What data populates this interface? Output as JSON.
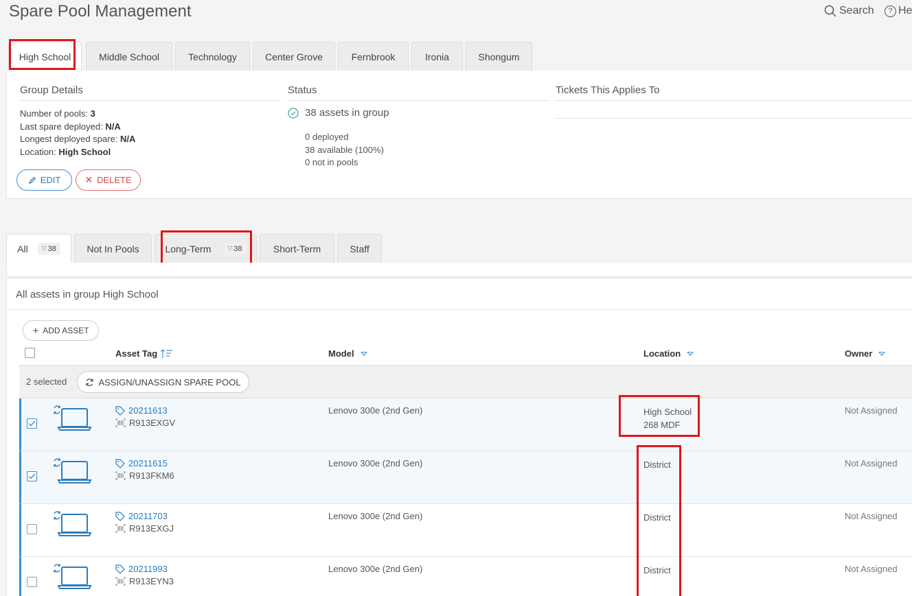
{
  "header": {
    "title": "Spare Pool Management",
    "search_label": "Search",
    "help_label": "He"
  },
  "group_tabs": [
    "High School",
    "Middle School",
    "Technology",
    "Center Grove",
    "Fernbrook",
    "Ironia",
    "Shongum"
  ],
  "group_details": {
    "heading": "Group Details",
    "pools_label": "Number of pools:",
    "pools_value": "3",
    "last_deployed_label": "Last spare deployed:",
    "last_deployed_value": "N/A",
    "longest_label": "Longest deployed spare:",
    "longest_value": "N/A",
    "location_label": "Location:",
    "location_value": "High School",
    "edit_label": "EDIT",
    "delete_label": "DELETE"
  },
  "status": {
    "heading": "Status",
    "summary": "38 assets in group",
    "deployed": "0 deployed",
    "available": "38 available (100%)",
    "not_in_pools": "0 not in pools"
  },
  "tickets": {
    "heading": "Tickets This Applies To"
  },
  "filter_tabs": {
    "all_label": "All",
    "all_count": "38",
    "not_in_pools_label": "Not In Pools",
    "long_term_label": "Long-Term",
    "long_term_count": "38",
    "short_term_label": "Short-Term",
    "staff_label": "Staff"
  },
  "assets": {
    "subtitle": "All assets in group High School",
    "add_asset_label": "ADD ASSET",
    "columns": {
      "asset_tag": "Asset Tag",
      "model": "Model",
      "location": "Location",
      "owner": "Owner"
    },
    "selected_text": "2 selected",
    "assign_label": "ASSIGN/UNASSIGN SPARE POOL",
    "rows": [
      {
        "tag": "20211613",
        "serial": "R913EXGV",
        "model": "Lenovo 300e (2nd Gen)",
        "location": "High School",
        "room": "268 MDF",
        "owner": "Not Assigned",
        "selected": true
      },
      {
        "tag": "20211615",
        "serial": "R913FKM6",
        "model": "Lenovo 300e (2nd Gen)",
        "location": "District",
        "room": "",
        "owner": "Not Assigned",
        "selected": true
      },
      {
        "tag": "20211703",
        "serial": "R913EXGJ",
        "model": "Lenovo 300e (2nd Gen)",
        "location": "District",
        "room": "",
        "owner": "Not Assigned",
        "selected": false
      },
      {
        "tag": "20211993",
        "serial": "R913EYN3",
        "model": "Lenovo 300e (2nd Gen)",
        "location": "District",
        "room": "",
        "owner": "Not Assigned",
        "selected": false
      }
    ]
  },
  "colors": {
    "accent": "#3b8fd0",
    "highlight": "#e0161b",
    "delete": "#d94848"
  }
}
